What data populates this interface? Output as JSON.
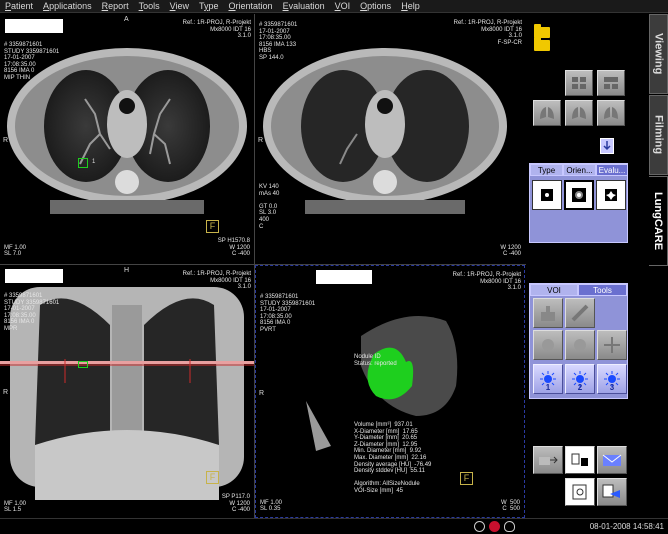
{
  "menu": {
    "items": [
      {
        "label": "Patient",
        "u": "P"
      },
      {
        "label": "Applications",
        "u": "A"
      },
      {
        "label": "Report",
        "u": "R"
      },
      {
        "label": "Tools",
        "u": "T"
      },
      {
        "label": "View",
        "u": "V"
      },
      {
        "label": "Type",
        "u": "y"
      },
      {
        "label": "Orientation",
        "u": "O"
      },
      {
        "label": "Evaluation",
        "u": "E"
      },
      {
        "label": "VOI",
        "u": "V"
      },
      {
        "label": "Options",
        "u": "O"
      },
      {
        "label": "Help",
        "u": "H"
      }
    ]
  },
  "viewports": {
    "vp1": {
      "top_right": "Ref.: 1R-PROJ, R-Projekt\nMx8000 IDT 16\n3.1.0",
      "top_left": "# 3359871601\nSTUDY 3359871601\n17-01-2007\n17:08:35.00\n8156 IMA 0\nMIP THIN",
      "bottom_left": "MF 1.00\nSL 7.0",
      "bottom_right": "SP H1570.8\nW 1200\nC -400",
      "side_marker": "R",
      "orient": "F",
      "roi_label": "1",
      "top_marker": "A"
    },
    "vp2": {
      "top_right": "Ref.: 1R-PROJ, R-Projekt\nMx8000 IDT 16\n3.1.0\nF-SP-CR",
      "top_left": "# 3359871601\n17-01-2007\n17:08:35.00\n8156 IMA 133\nHBS\nSP 144.0",
      "middle_left": "KV 140\nmAs 40\n\nGT 0.0\nSL 3.0\n400\nC",
      "bottom_right": "W 1200\nC -400",
      "side_marker": "R"
    },
    "vp3": {
      "top_right": "Ref.: 1R-PROJ, R-Projekt\nMx8000 IDT 16\n3.1.0",
      "top_left": "# 3359871601\nSTUDY 3359871601\n17-01-2007\n17:08:35.00\n8156 IMA 0\nMPR",
      "bottom_left": "MF 1.00\nSL 1.5",
      "bottom_right": "SP P117.0\nW 1200\nC -400",
      "side_marker": "R",
      "top_marker": "H",
      "orient": "F"
    },
    "vp4": {
      "top_right": "Ref.: 1R-PROJ, R-Projekt\nMx8000 IDT 16\n3.1.0",
      "top_left": "# 3359871601\nSTUDY 3359871601\n17-01-2007\n17:08:35.00\n8156 IMA 0\nPVRT",
      "nodule": "Nodule ID\nStatus: reported",
      "measurements": "Volume [mm³]  937.01\nX-Diameter [mm]  17.65\nY-Diameter [mm]  20.65\nZ-Diameter [mm]  12.95\nMin. Diameter [mm]  9.92\nMax. Diameter [mm]  22.16\nDensity average [HU]  -76.49\nDensity stddev [HU]  55.11\n\nAlgorithm: AllSizeNodule\nVOI-Size [mm]  45",
      "bottom_left": "MF 1.00\nSL 0.35",
      "bottom_right": "W  500\nC  500",
      "side_marker": "R",
      "orient": "F"
    }
  },
  "right_panel": {
    "side_tabs": [
      "Viewing",
      "Filming",
      "LungCARE"
    ],
    "type_tabs": [
      "Type",
      "Orien...",
      "Evalu..."
    ],
    "voi_tabs": [
      "VOI",
      "Tools"
    ],
    "voi_numbers": [
      "1",
      "2",
      "3"
    ]
  },
  "status": {
    "datetime": "08-01-2008 14:58:41"
  },
  "colors": {
    "panel": "#8f93d8",
    "accent_green": "#1ecf1e",
    "folder": "#f0c800"
  }
}
